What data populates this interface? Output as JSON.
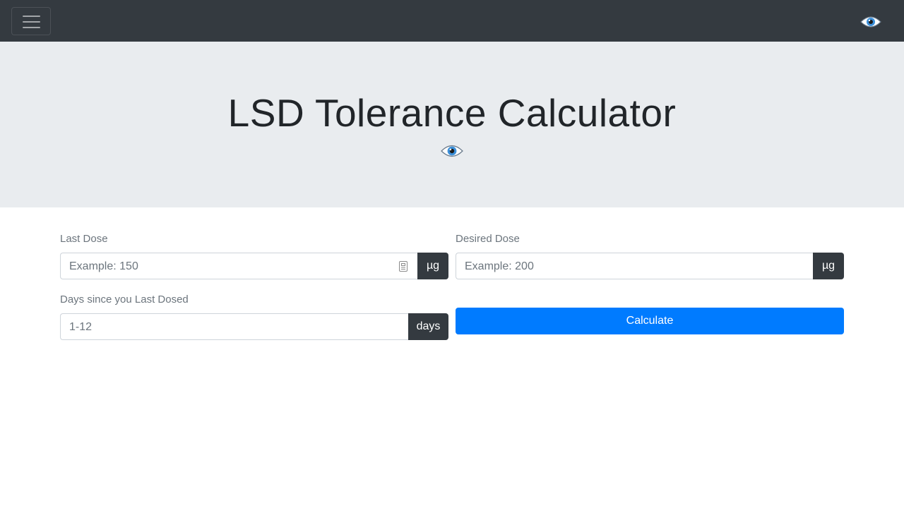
{
  "navbar": {
    "toggler_icon": "hamburger-icon",
    "brand_icon": "eye-icon"
  },
  "hero": {
    "title": "LSD Tolerance Calculator",
    "icon": "eye-icon"
  },
  "form": {
    "last_dose": {
      "label": "Last Dose",
      "placeholder": "Example: 150",
      "unit": "µg"
    },
    "desired_dose": {
      "label": "Desired Dose",
      "placeholder": "Example: 200",
      "unit": "µg"
    },
    "days_since": {
      "label": "Days since you Last Dosed",
      "placeholder": "1-12",
      "unit": "days"
    },
    "calculate_label": "Calculate"
  },
  "colors": {
    "navbar": "#343a40",
    "jumbotron": "#e9ecef",
    "primary": "#007bff",
    "addon": "#343a40"
  }
}
